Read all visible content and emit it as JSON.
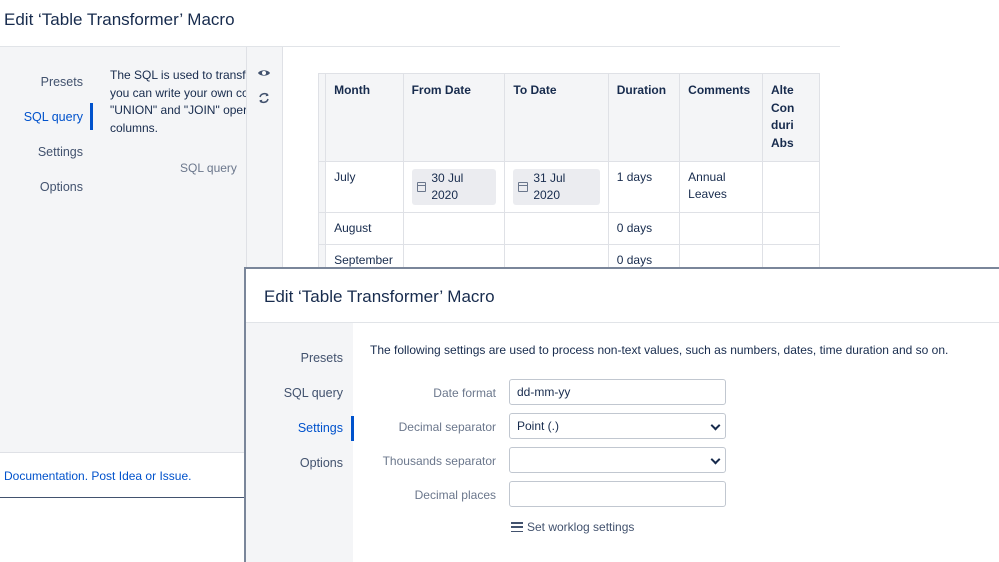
{
  "bg_dialog": {
    "title": "Edit ‘Table Transformer’ Macro",
    "nav": [
      "Presets",
      "SQL query",
      "Settings",
      "Options"
    ],
    "active_nav": "SQL query",
    "description_lines": [
      "The SQL is used to transfo",
      "you can write your own co",
      "\"UNION\" and \"JOIN\" oper",
      "columns."
    ],
    "sql_query_label": "SQL query",
    "icons": [
      "eye-icon",
      "refresh-icon"
    ],
    "footer": {
      "documentation": "Documentation.",
      "post": " Post ",
      "idea": "Idea",
      "or": " or ",
      "issue": "Issue",
      "end": "."
    },
    "table": {
      "headers": [
        "Month",
        "From Date",
        "To Date",
        "Duration",
        "Comments",
        "Alte Con duri Abs"
      ],
      "rows": [
        {
          "month": "July",
          "from": "30 Jul 2020",
          "to": "31 Jul 2020",
          "duration": "1 days",
          "comments": "Annual Leaves"
        },
        {
          "month": "August",
          "from": "",
          "to": "",
          "duration": "0 days",
          "comments": ""
        },
        {
          "month": "September",
          "from": "",
          "to": "",
          "duration": "0 days",
          "comments": ""
        }
      ]
    }
  },
  "fg_dialog": {
    "title": "Edit ‘Table Transformer’ Macro",
    "nav": [
      "Presets",
      "SQL query",
      "Settings",
      "Options"
    ],
    "active_nav": "Settings",
    "description": "The following settings are used to process non-text values, such as numbers, dates, time duration and so on.",
    "fields": {
      "date_format": {
        "label": "Date format",
        "value": "dd-mm-yy"
      },
      "decimal_separator": {
        "label": "Decimal separator",
        "value": "Point (.)"
      },
      "thousands_separator": {
        "label": "Thousands separator",
        "value": ""
      },
      "decimal_places": {
        "label": "Decimal places",
        "value": ""
      }
    },
    "worklog_link": "Set worklog settings"
  },
  "colors": {
    "accent": "#0052cc",
    "sidebar_bg": "#f4f5f7",
    "text": "#172b4d",
    "muted": "#6b778c"
  }
}
